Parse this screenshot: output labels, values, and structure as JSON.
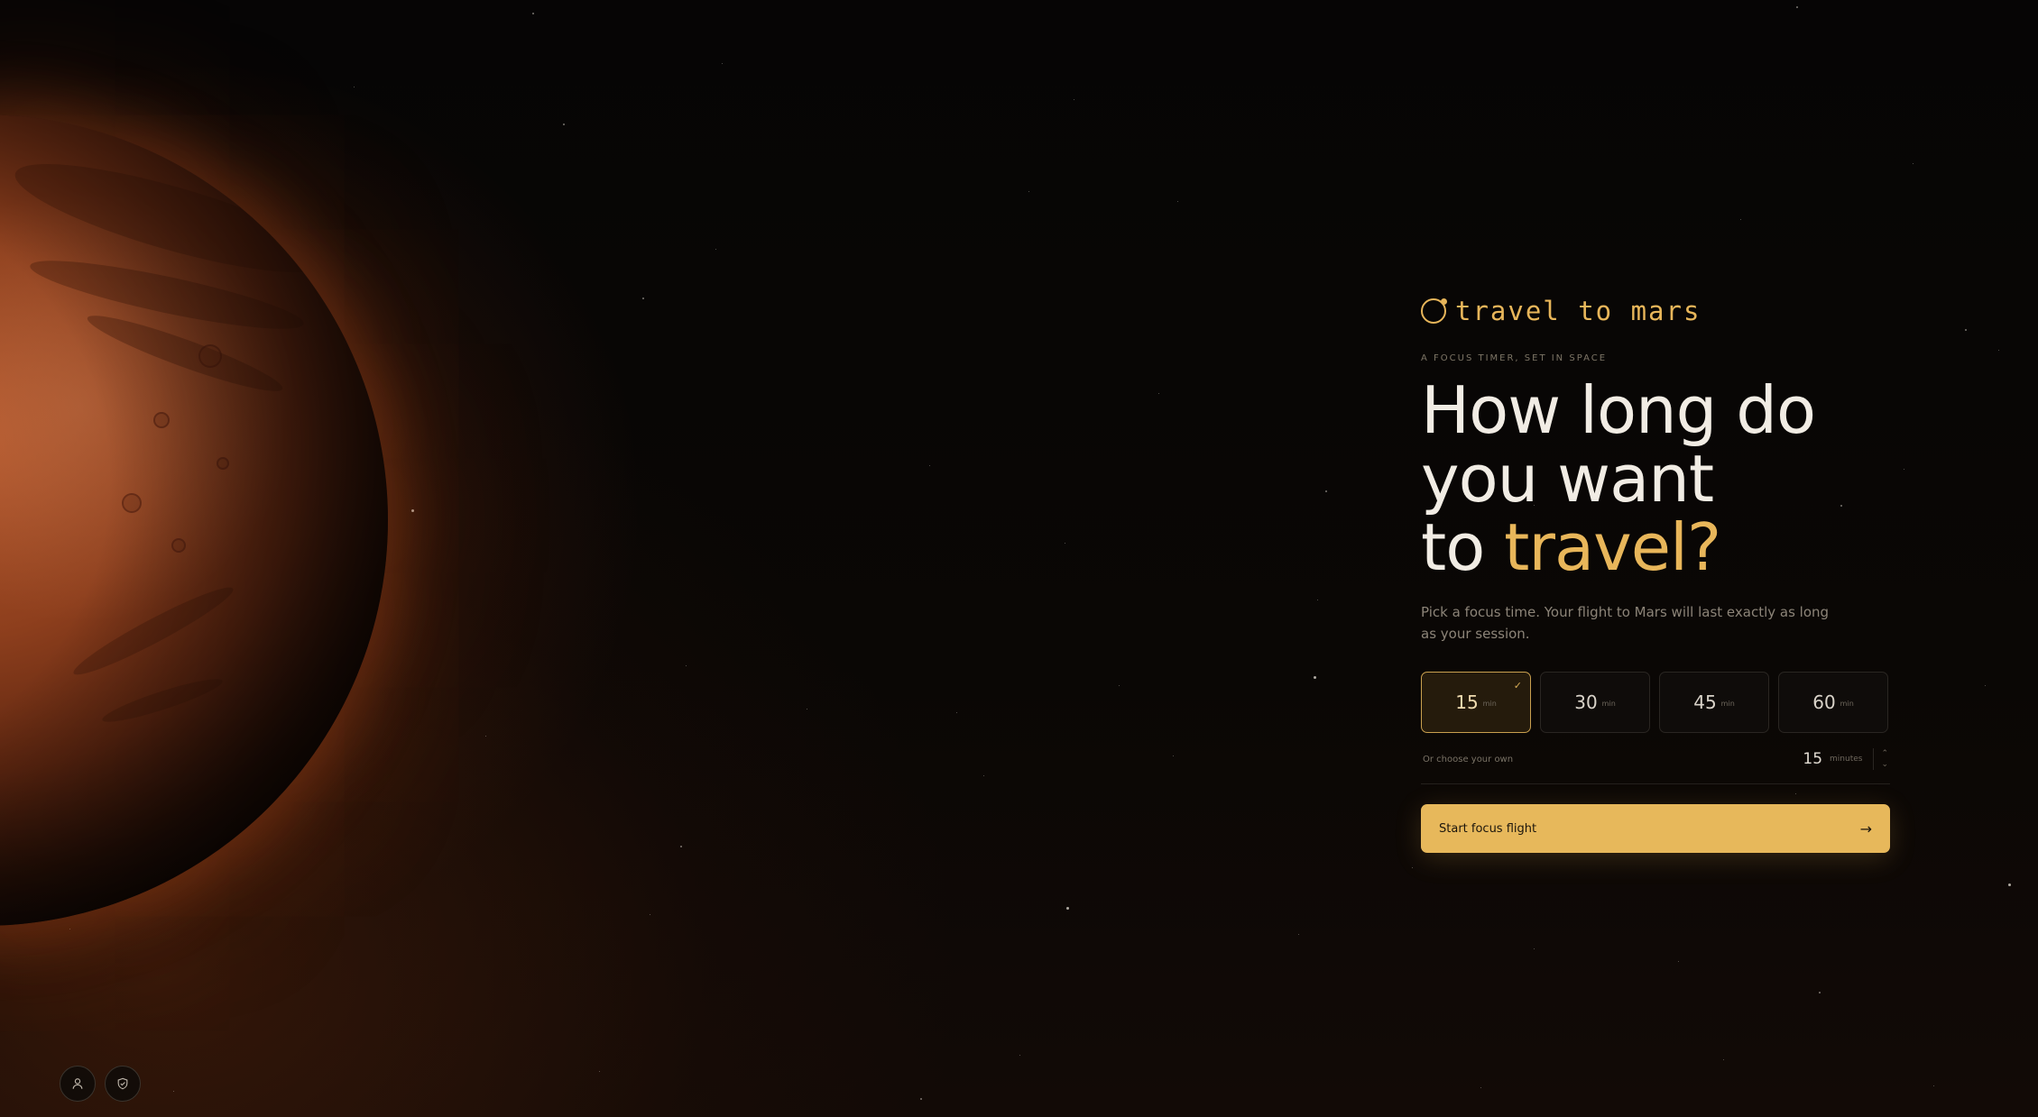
{
  "brand": {
    "name": "travel to mars",
    "icon": "planet-orbit-icon"
  },
  "eyebrow": "A FOCUS TIMER, SET IN SPACE",
  "headline": {
    "line1": "How long do",
    "line2": "you want",
    "line3_prefix": "to ",
    "line3_accent": "travel?"
  },
  "subtitle": "Pick a focus time. Your flight to Mars will last exactly as long as your session.",
  "durations": [
    {
      "value": "15",
      "unit": "min",
      "selected": true
    },
    {
      "value": "30",
      "unit": "min",
      "selected": false
    },
    {
      "value": "45",
      "unit": "min",
      "selected": false
    },
    {
      "value": "60",
      "unit": "min",
      "selected": false
    }
  ],
  "custom": {
    "label": "Or choose your own",
    "value": "15",
    "unit": "minutes",
    "increment_icon": "chevron-up-icon",
    "decrement_icon": "chevron-down-icon"
  },
  "cta": {
    "label": "Start focus flight",
    "icon": "arrow-right-icon"
  },
  "corner": {
    "profile_icon": "user-icon",
    "privacy_icon": "shield-check-icon"
  },
  "colors": {
    "accent": "#e8b65a",
    "background": "#090706",
    "planet": "#8e3f1d"
  }
}
